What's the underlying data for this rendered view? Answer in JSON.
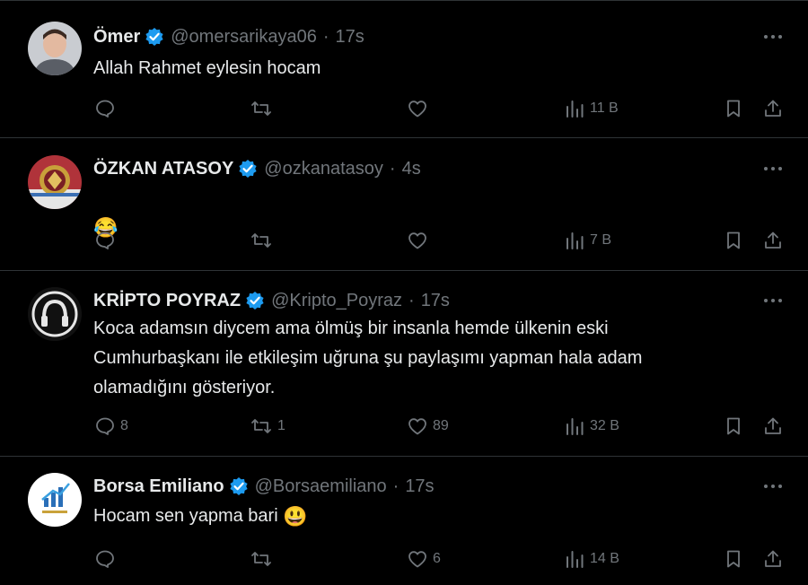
{
  "colors": {
    "background": "#000000",
    "text": "#e7e9ea",
    "muted": "#71767b",
    "divider": "#2f3336",
    "verified": "#1d9bf0"
  },
  "posts": [
    {
      "name": "Ömer",
      "handle": "@omersarikaya06",
      "separator": "·",
      "time": "17s",
      "text": "Allah Rahmet eylesin hocam",
      "emoji": "",
      "avatar_icon": "portrait-photo",
      "counts": {
        "reply": "",
        "repost": "",
        "like": "",
        "views": "11 B"
      }
    },
    {
      "name": "ÖZKAN ATASOY",
      "handle": "@ozkanatasoy",
      "separator": "·",
      "time": "4s",
      "text": "",
      "emoji": "😂",
      "avatar_icon": "emblem-badge",
      "counts": {
        "reply": "",
        "repost": "",
        "like": "",
        "views": "7 B"
      }
    },
    {
      "name": "KRİPTO POYRAZ",
      "handle": "@Kripto_Poyraz",
      "separator": "·",
      "time": "17s",
      "text": "Koca adamsın diycem ama ölmüş bir insanla hemde ülkenin eski\nCumhurbaşkanı ile etkileşim uğruna şu paylaşımı yapman hala adam\nolamadığını gösteriyor.",
      "emoji": "",
      "avatar_icon": "headphones-logo",
      "counts": {
        "reply": "8",
        "repost": "1",
        "like": "89",
        "views": "32 B"
      }
    },
    {
      "name": "Borsa Emiliano",
      "handle": "@Borsaemiliano",
      "separator": "·",
      "time": "17s",
      "text": "Hocam sen yapma bari",
      "emoji": "😃",
      "avatar_icon": "chart-logo",
      "counts": {
        "reply": "",
        "repost": "",
        "like": "6",
        "views": "14 B"
      }
    }
  ]
}
